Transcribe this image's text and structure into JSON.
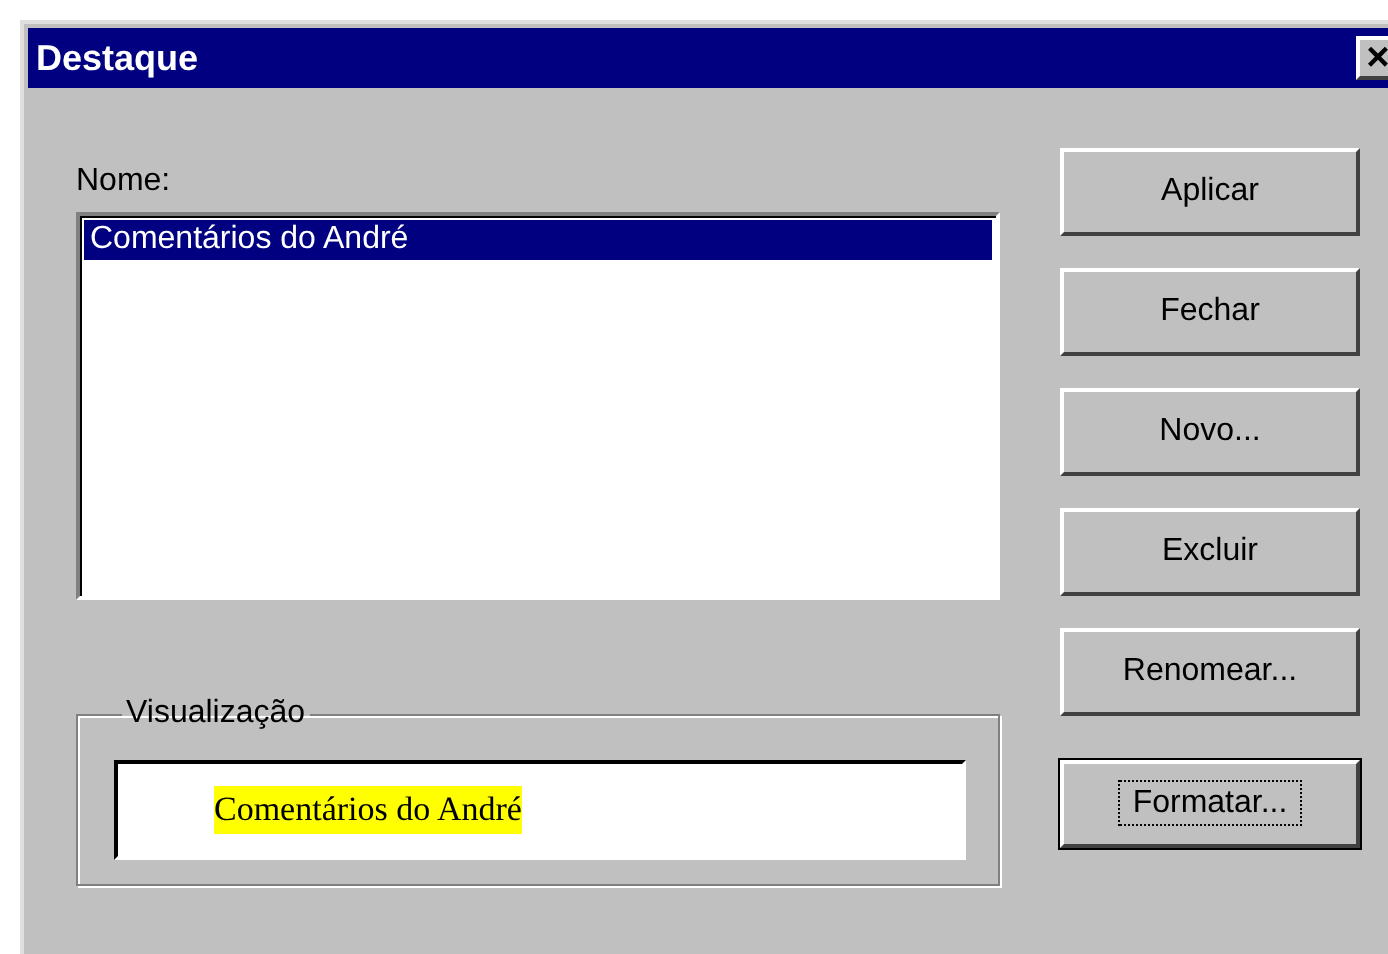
{
  "window": {
    "title": "Destaque",
    "close": "×"
  },
  "name_list": {
    "label": "Nome:",
    "items": [
      {
        "text": "Comentários do André",
        "selected": true
      }
    ]
  },
  "preview": {
    "group_label": "Visualização",
    "sample": "Comentários do André",
    "color": "#ffff00"
  },
  "buttons": [
    {
      "label": "Aplicar",
      "focused": false
    },
    {
      "label": "Fechar",
      "focused": false
    },
    {
      "label": "Novo...",
      "focused": false
    },
    {
      "label": "Excluir",
      "focused": false
    },
    {
      "label": "Renomear...",
      "focused": false
    },
    {
      "label": "Formatar...",
      "focused": true
    }
  ]
}
